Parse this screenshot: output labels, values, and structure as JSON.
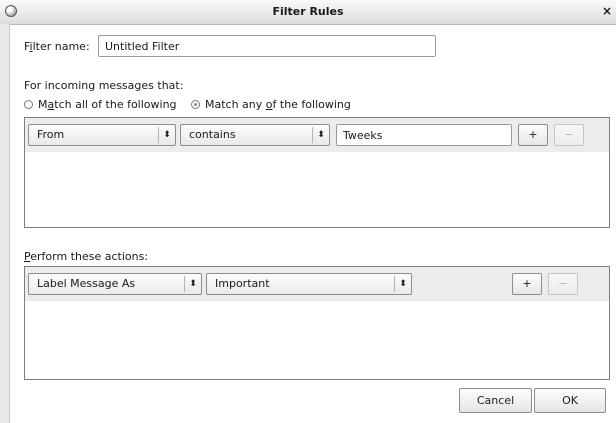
{
  "window": {
    "title": "Filter Rules",
    "close_glyph": "×",
    "icon": "app-icon"
  },
  "filter_name": {
    "label_pre": "F",
    "label_mnemonic": "i",
    "label_post": "lter name:",
    "value": "Untitled Filter"
  },
  "incoming": {
    "label": "For incoming messages that:",
    "match_all": {
      "pre": "M",
      "mnemonic": "a",
      "post": "tch all of the following",
      "selected": false
    },
    "match_any": {
      "pre": "Match any ",
      "mnemonic": "o",
      "post": "f the following",
      "selected": true
    }
  },
  "conditions": [
    {
      "field": "From",
      "operator": "contains",
      "value": "Tweeks",
      "add_label": "+",
      "remove_label": "−"
    }
  ],
  "actions_label": {
    "mnemonic": "P",
    "post": "erform these actions:"
  },
  "actions": [
    {
      "action": "Label Message As",
      "value": "Important",
      "add_label": "+",
      "remove_label": "−"
    }
  ],
  "select_arrow": "⬍",
  "footer": {
    "cancel_label": "Cancel",
    "ok_label": "OK"
  }
}
